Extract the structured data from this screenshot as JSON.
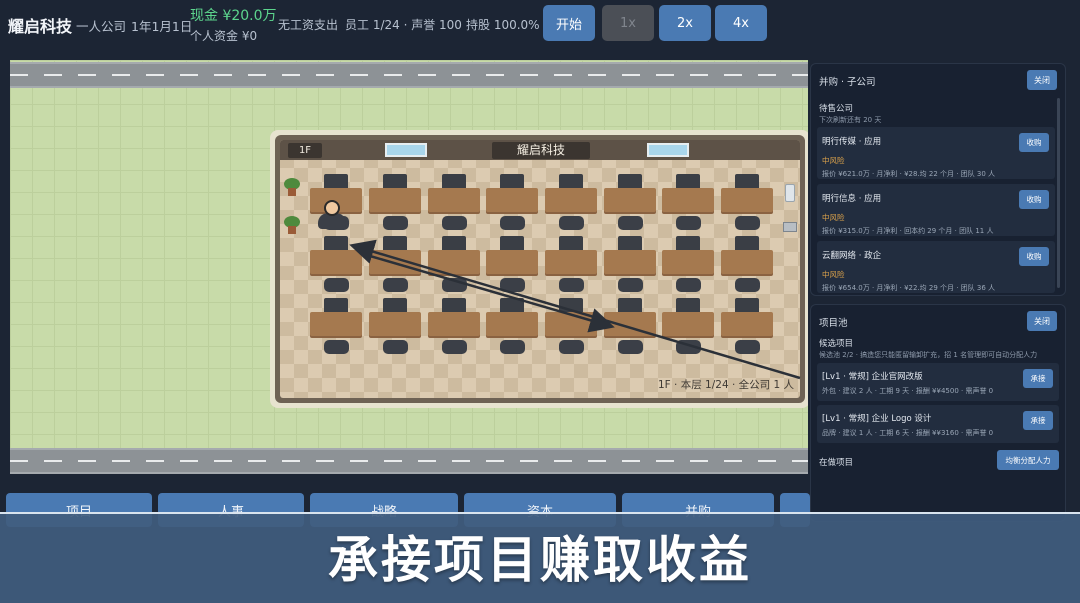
{
  "topbar": {
    "company_name": "耀启科技",
    "company_type": "一人公司",
    "date": "1年1月1日",
    "cash": "现金 ¥20.0万",
    "personal_funds": "个人资金 ¥0",
    "payroll": "无工资支出",
    "staff_reputation": "员工 1/24 · 声誉 100",
    "shareholding": "持股 100.0%",
    "buttons": {
      "start": "开始",
      "speed1": "1x",
      "speed2": "2x",
      "speed4": "4x"
    }
  },
  "office": {
    "floor_label": "1F",
    "name": "耀启科技",
    "status": "1F · 本层 1/24 · 全公司 1 人"
  },
  "acquisition": {
    "title": "并购 · 子公司",
    "close": "关闭",
    "section": "待售公司",
    "refresh_note": "下次刷新还有 20 天",
    "companies": [
      {
        "name": "明行传媒 · 应用",
        "risk": "中风险",
        "info": "报价 ¥621.0万 · 月净利 · ¥28.均 22 个月 · 团队 30 人",
        "action": "收购"
      },
      {
        "name": "明行信息 · 应用",
        "risk": "中风险",
        "info": "报价 ¥315.0万 · 月净利 · 回本约 29 个月 · 团队 11 人",
        "action": "收购"
      },
      {
        "name": "云翻网络 · 政企",
        "risk": "中风险",
        "info": "报价 ¥654.0万 · 月净利 · ¥22.均 29 个月 · 团队 36 人",
        "action": "收购"
      }
    ]
  },
  "projects": {
    "title": "项目池",
    "close": "关闭",
    "candidates_title": "候选项目",
    "candidates_note": "候选池 2/2 · 搞造您只能匿留输卸扩充，招 1 名管理即可自动分配人力",
    "items": [
      {
        "name": "[Lv1 · 常规] 企业官网改版",
        "info": "外包 · 建议 2 人 · 工期 9 天 · 报酬 ¥¥4500 · 需声誉 0",
        "action": "承接"
      },
      {
        "name": "[Lv1 · 常规] 企业 Logo 设计",
        "info": "品牌 · 建议 1 人 · 工期 6 天 · 报酬 ¥¥3160 · 需声誉 0",
        "action": "承接"
      }
    ],
    "in_progress_title": "在做项目",
    "assign_button": "均衡分配人力"
  },
  "tabs": [
    "项目",
    "人事",
    "战略",
    "资本",
    "并购",
    ""
  ],
  "caption": "承接项目赚取收益",
  "colors": {
    "accent": "#4a7ab3",
    "cash": "#5cd58d",
    "risk": "#e2a64b",
    "background": "#1c2534"
  }
}
